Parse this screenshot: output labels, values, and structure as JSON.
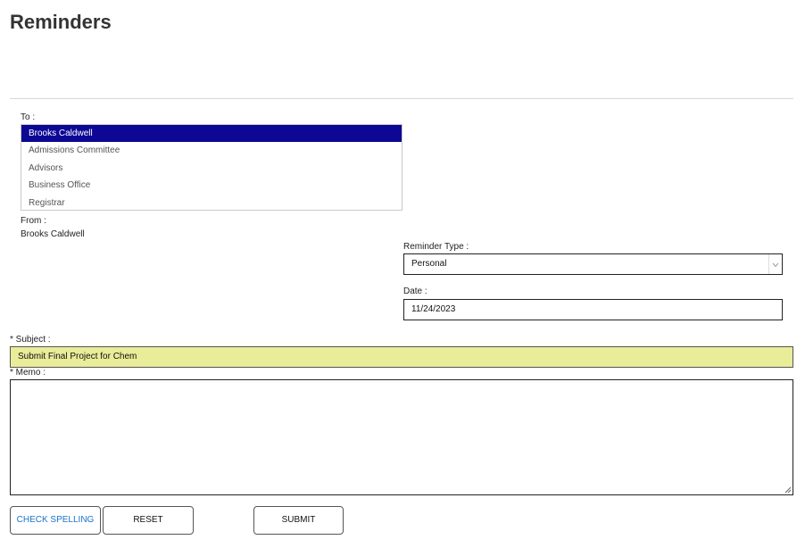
{
  "page": {
    "title": "Reminders"
  },
  "to": {
    "label": "To :",
    "items": [
      "Brooks Caldwell",
      "Admissions Committee",
      "Advisors",
      "Business Office",
      "Registrar"
    ],
    "selected": "Brooks Caldwell"
  },
  "from": {
    "label": "From :",
    "value": "Brooks Caldwell"
  },
  "reminder_type": {
    "label": "Reminder Type :",
    "value": "Personal"
  },
  "date": {
    "label": "Date :",
    "value": "11/24/2023"
  },
  "subject": {
    "label": "* Subject :",
    "value": "Submit Final Project for Chem"
  },
  "memo": {
    "label": "* Memo :",
    "value": ""
  },
  "buttons": {
    "check_spelling": "CHECK SPELLING",
    "reset": "RESET",
    "submit": "SUBMIT"
  },
  "colors": {
    "selected_bg": "#0c0794",
    "subject_bg": "#e9ec98",
    "link_blue": "#1a73c8"
  },
  "icons": {
    "select_arrow": "chevron-down-icon",
    "resize": "resize-grip-icon"
  }
}
